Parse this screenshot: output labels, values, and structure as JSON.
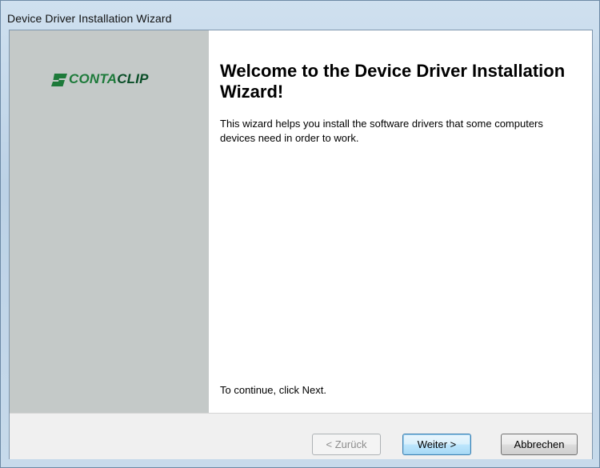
{
  "window": {
    "title": "Device Driver Installation Wizard"
  },
  "side_panel": {
    "logo_text_part1": "CONTA",
    "logo_text_part2": "CLIP",
    "logo_color": "#1d7a3a",
    "panel_color": "#c4c9c8"
  },
  "content": {
    "heading": "Welcome to the Device Driver Installation Wizard!",
    "intro": "This wizard helps you install the software drivers that some computers devices need in order to work.",
    "continue_hint": "To continue, click Next."
  },
  "buttons": {
    "back_label": "< Zurück",
    "next_label": "Weiter >",
    "cancel_label": "Abbrechen"
  }
}
